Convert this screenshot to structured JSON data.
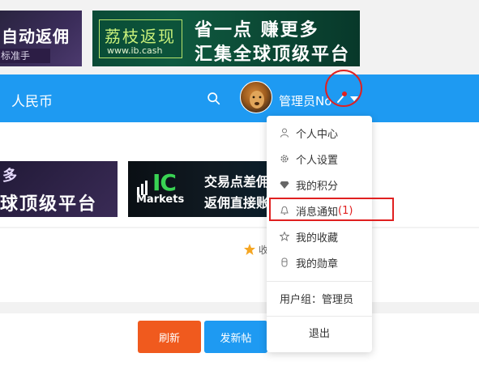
{
  "banners": {
    "top_left": {
      "line1": "自动返佣",
      "line2": "标准手"
    },
    "top_ib": {
      "logo_cn": "荔枝返现",
      "logo_url": "www.ib.cash",
      "line1": "省一点 赚更多",
      "line2": "汇集全球顶级平台"
    },
    "mid_left": {
      "line1": "多",
      "line2": "球顶级平台"
    },
    "mid_ic": {
      "brand_big": "IC",
      "brand_sub": "Markets",
      "line1": "交易点差佣",
      "line2": "返佣直接账"
    }
  },
  "navbar": {
    "currency_label": "人民币",
    "search_icon": "search-icon",
    "username": "管理员No",
    "bell_icon": "bell-icon",
    "accent_color": "#1e9af2"
  },
  "dropdown": {
    "items": [
      {
        "label": "个人中心",
        "icon": "user-icon"
      },
      {
        "label": "个人设置",
        "icon": "gear-icon"
      },
      {
        "label": "我的积分",
        "icon": "diamond-icon"
      },
      {
        "label": "消息通知",
        "count": "(1)",
        "icon": "bell-icon"
      },
      {
        "label": "我的收藏",
        "icon": "star-outline-icon"
      },
      {
        "label": "我的勋章",
        "icon": "medal-icon"
      }
    ],
    "user_group": "用户组：管理员",
    "logout_label": "退出"
  },
  "content": {
    "collect_fragment": "收"
  },
  "actions": {
    "refresh_label": "刷新",
    "new_post_label": "发新帖",
    "refresh_color": "#f05a1e",
    "new_post_color": "#1e9af2"
  },
  "annotation_color": "#e02020"
}
